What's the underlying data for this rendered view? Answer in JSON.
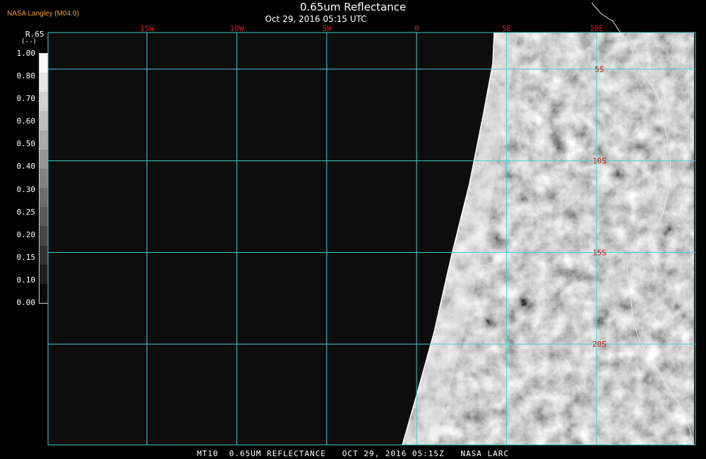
{
  "producer": "NASA Langley (M04.0)",
  "title": "0.65um Reflectance",
  "subtitle": "Oct 29, 2016 05:15 UTC",
  "colorbar": {
    "name": "R.65",
    "units": "(--)",
    "ticks": [
      "1.00",
      "0.80",
      "0.70",
      "0.60",
      "0.50",
      "0.40",
      "0.30",
      "0.25",
      "0.20",
      "0.15",
      "0.10",
      "0.00"
    ],
    "tick_values": [
      1.0,
      0.8,
      0.7,
      0.6,
      0.5,
      0.4,
      0.3,
      0.25,
      0.2,
      0.15,
      0.1,
      0.0
    ],
    "steps": [
      "#f8f8f8",
      "#e6e6e6",
      "#d2d2d2",
      "#bebebe",
      "#aaaaaa",
      "#969696",
      "#828282",
      "#6e6e6e",
      "#5a5a5a",
      "#464646",
      "#323232",
      "#1e1e1e",
      "#0a0a0a"
    ]
  },
  "map": {
    "lon_range": [
      -20.5,
      15.5
    ],
    "lat_range": [
      -25.5,
      -3.0
    ],
    "lon_labels": [
      "15W",
      "10W",
      "5W",
      "0",
      "5E",
      "10E"
    ],
    "lon_values": [
      -15,
      -10,
      -5,
      0,
      5,
      10
    ],
    "lat_labels": [
      "5S",
      "10S",
      "15S",
      "20S"
    ],
    "lat_values": [
      -5,
      -10,
      -15,
      -20
    ],
    "label_lon": 10,
    "grid_color": "#40d0d0",
    "label_color": "#d02020",
    "background": "#0d0d0d",
    "space_color": "#000000"
  },
  "footer": "MT10  0.65UM REFLECTANCE   OCT 29, 2016 05:15Z   NASA LARC"
}
